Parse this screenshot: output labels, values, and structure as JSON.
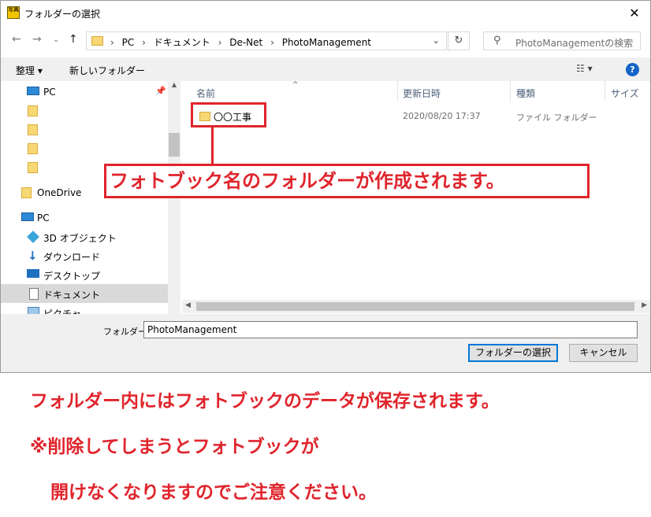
{
  "window": {
    "title": "フォルダーの選択",
    "close_label": "✕",
    "app_icon_text": "写真"
  },
  "address_bar": {
    "breadcrumbs": [
      "PC",
      "ドキュメント",
      "De-Net",
      "PhotoManagement"
    ],
    "search_placeholder": "PhotoManagementの検索"
  },
  "toolbar": {
    "organize_label": "整理 ▾",
    "new_folder_label": "新しいフォルダー",
    "help_label": "?"
  },
  "nav_pane": {
    "quick_access_label": "PC",
    "items": [
      {
        "label": "",
        "icon": "folder-icon"
      },
      {
        "label": "",
        "icon": "folder-icon"
      },
      {
        "label": "",
        "icon": "folder-icon"
      },
      {
        "label": "",
        "icon": "folder-icon"
      },
      {
        "label": "OneDrive",
        "icon": "folder-icon"
      },
      {
        "label": "PC",
        "icon": "pc-icon"
      },
      {
        "label": "3D オブジェクト",
        "icon": "3d-objects-icon"
      },
      {
        "label": "ダウンロード",
        "icon": "download-icon"
      },
      {
        "label": "デスクトップ",
        "icon": "desktop-icon"
      },
      {
        "label": "ドキュメント",
        "icon": "document-icon",
        "selected": true
      },
      {
        "label": "ピクチャ",
        "icon": "pictures-icon"
      }
    ]
  },
  "file_list": {
    "columns": [
      "名前",
      "更新日時",
      "種類",
      "サイズ"
    ],
    "rows": [
      {
        "name": "〇〇工事",
        "modified": "2020/08/20 17:37",
        "type": "ファイル フォルダー"
      }
    ]
  },
  "bottom": {
    "folder_label": "フォルダー:",
    "folder_value": "PhotoManagement",
    "select_button": "フォルダーの選択",
    "cancel_button": "キャンセル"
  },
  "annotations": {
    "callout": "フォトブック名のフォルダーが作成されます。",
    "note1": "フォルダー内にはフォトブックのデータが保存されます。",
    "note2": "※削除してしまうとフォトブックが",
    "note3": "開けなくなりますのでご注意ください。",
    "accent_color": "#e0242c"
  }
}
